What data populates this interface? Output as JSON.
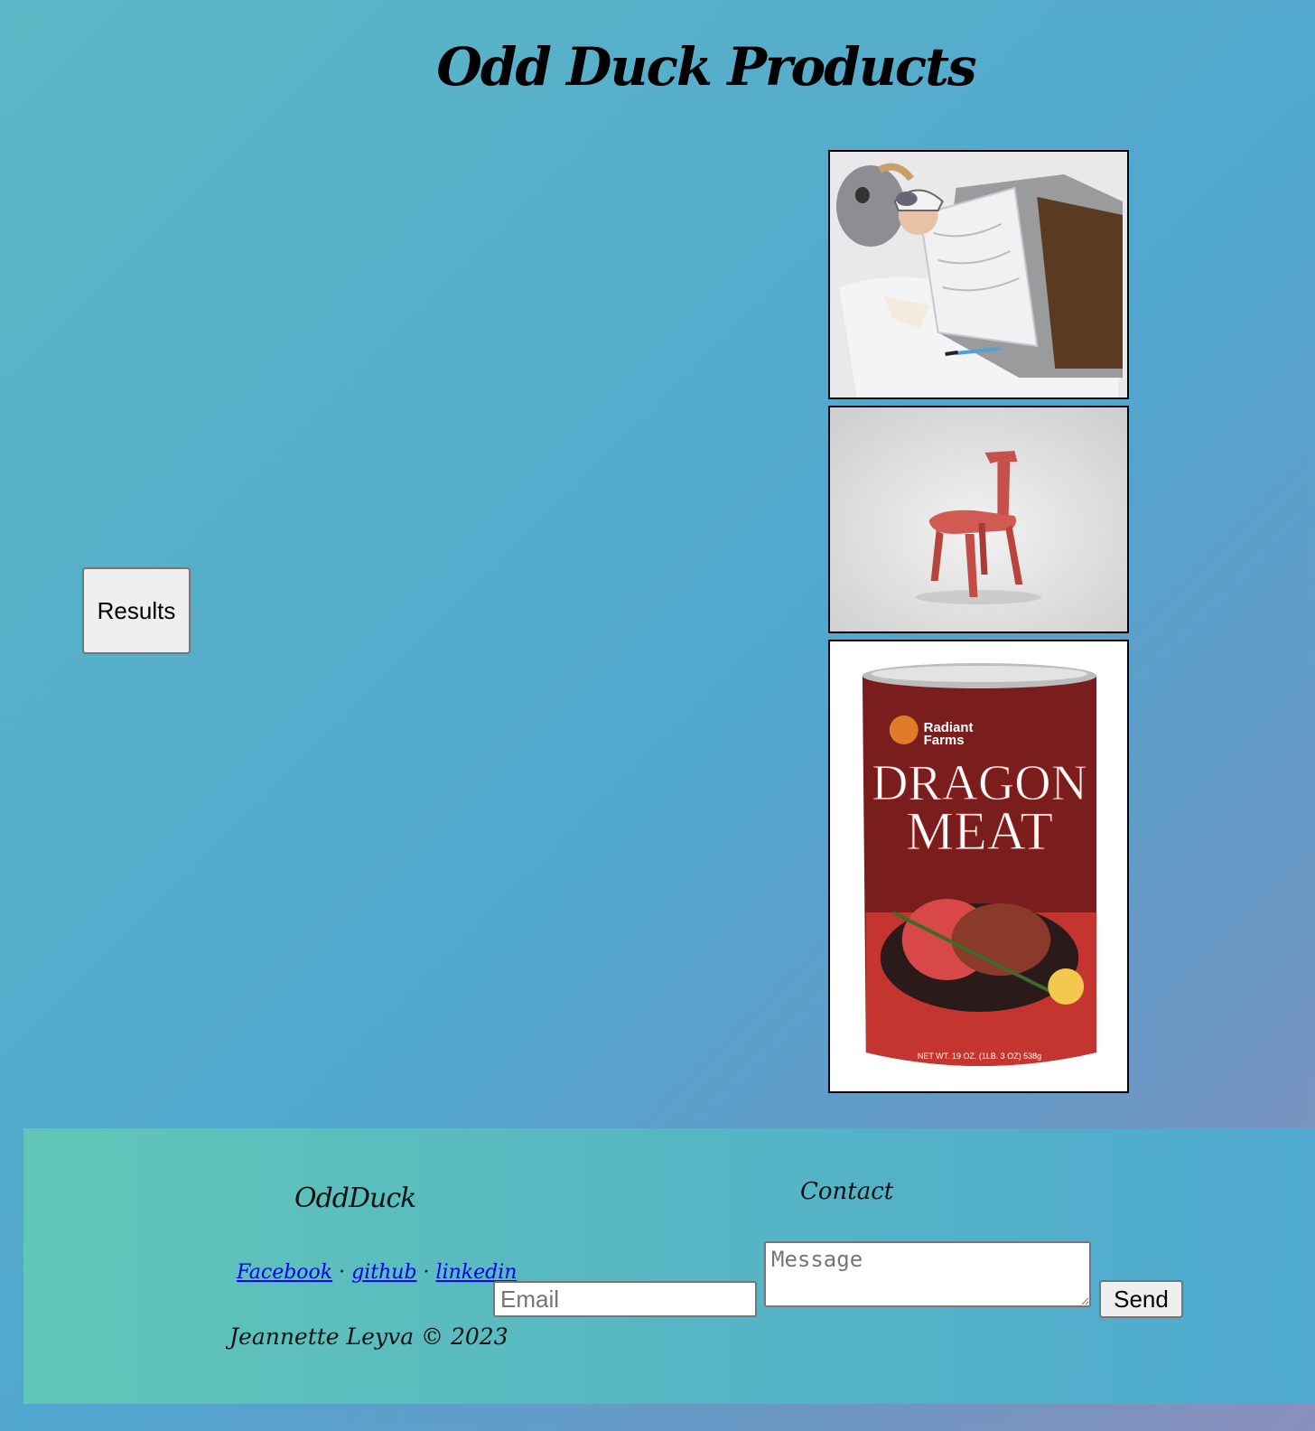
{
  "header": {
    "title": "Odd Duck Products"
  },
  "main": {
    "results_label": "Results",
    "images": [
      {
        "name": "tauntaun-sleeping-bag",
        "icon": "product-photo"
      },
      {
        "name": "chair",
        "icon": "product-photo"
      },
      {
        "name": "dragon-meat",
        "icon": "product-photo"
      }
    ]
  },
  "footer": {
    "brand": "OddDuck",
    "contact_title": "Contact",
    "links": [
      "Facebook",
      "github",
      "linkedin"
    ],
    "separator": "·",
    "copyright": "Jeannette Leyva © 2023",
    "email_placeholder": "Email",
    "message_placeholder": "Message",
    "send_label": "Send"
  },
  "colors": {
    "footer_bg": "#5bbdc0",
    "link": "#0000ee",
    "button_bg": "#efefef"
  }
}
